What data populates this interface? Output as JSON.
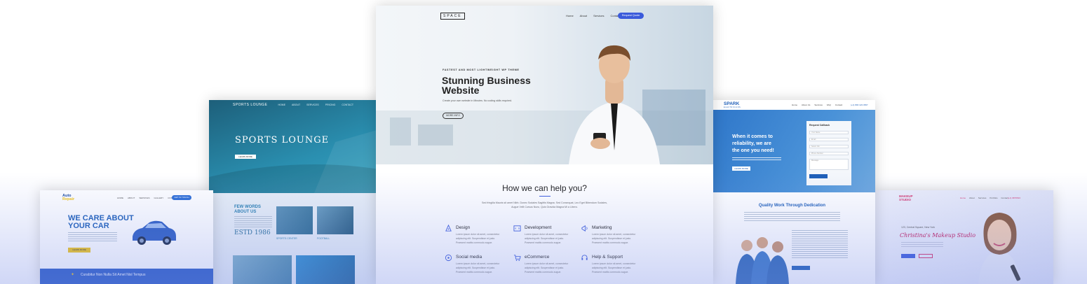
{
  "space": {
    "logo": "SPACE",
    "nav": [
      "Home",
      "About",
      "Services",
      "Contact"
    ],
    "request_button": "Request Quote",
    "kicker": "FASTEST AND MOST LIGHTWEIGHT WP THEME",
    "headline": "Stunning Business Website",
    "subtext": "Create your own website in Minutes. No coding skills required.",
    "more_button": "MORE INFO",
    "help_title": "How we can help you?",
    "intro_line1": "Sed fringilla Mauris sit amet Nibh. Donec Sodales Sagittis Magna. Sed Consequat, Leo Eget Bibendum Sodales,",
    "intro_line2": "Augue Velit Cursus Nunc, Quis Gravida Magna Mi a Libero.",
    "services": [
      {
        "name": "Design",
        "icon": "pen-tool-icon",
        "lines": [
          "Lorem ipsum dolor sit amet, consectetur",
          "adipiscing elit. Suspendisse et justo.",
          "Praesent mattis commodo augue."
        ]
      },
      {
        "name": "Development",
        "icon": "code-window-icon",
        "lines": [
          "Lorem ipsum dolor sit amet, consectetur",
          "adipiscing elit. Suspendisse et justo.",
          "Praesent mattis commodo augue."
        ]
      },
      {
        "name": "Marketing",
        "icon": "megaphone-icon",
        "lines": [
          "Lorem ipsum dolor sit amet, consectetur",
          "adipiscing elit. Suspendisse et justo.",
          "Praesent mattis commodo augue."
        ]
      },
      {
        "name": "Social media",
        "icon": "share-icon",
        "lines": [
          "Lorem ipsum dolor sit amet, consectetur",
          "adipiscing elit. Suspendisse et justo.",
          "Praesent mattis commodo augue."
        ]
      },
      {
        "name": "eCommerce",
        "icon": "cart-icon",
        "lines": [
          "Lorem ipsum dolor sit amet, consectetur",
          "adipiscing elit. Suspendisse et justo.",
          "Praesent mattis commodo augue."
        ]
      },
      {
        "name": "Help & Support",
        "icon": "support-icon",
        "lines": [
          "Lorem ipsum dolor sit amet, consectetur",
          "adipiscing elit. Suspendisse et justo.",
          "Praesent mattis commodo augue."
        ]
      }
    ]
  },
  "sports": {
    "logo": "SPORTS LOUNGE",
    "nav": [
      "HOME",
      "ABOUT",
      "SERVICES",
      "PRICING",
      "CONTACT"
    ],
    "title": "SPORTS LOUNGE",
    "button": "LEARN MORE",
    "few_words": "FEW WORDS ABOUT US",
    "estd": "ESTD 1986",
    "caption1": "SPORTS CENTER",
    "caption2": "FOOTBALL"
  },
  "auto": {
    "logo_line1": "Auto",
    "logo_line2": "Repair",
    "nav": [
      "HOME",
      "ABOUT",
      "SERVICES",
      "GALLERY",
      "CONTACT"
    ],
    "cta": "GET IN TOUCH",
    "headline_line1": "WE CARE ABOUT",
    "headline_line2": "YOUR CAR",
    "button": "LEARN MORE",
    "strip_text": "Curabitur Non Nulla Sit Amet Nisl Tempus"
  },
  "spark": {
    "logo": "SPARK",
    "logo_sub": "ELECTRICIANS",
    "nav": [
      "Home",
      "About Us",
      "Services",
      "FAQ",
      "Contact"
    ],
    "phone": "(+1) 800 123 4567",
    "hero_line1": "When it comes to",
    "hero_line2": "reliability, we are",
    "hero_line3": "the one you need!",
    "hero_button": "LEARN MORE",
    "form_title": "Request Callback",
    "form_fields": [
      "Your Name",
      "Email",
      "Select Job",
      "Phone Number",
      "Message"
    ],
    "quality_title": "Quality Work Through Dedication"
  },
  "makeup": {
    "logo_line1": "MAKEUP",
    "logo_line2": "STUDIO",
    "nav": [
      "Home",
      "About",
      "Services",
      "Portfolio",
      "Contact"
    ],
    "phone": "(+1) 9876543",
    "address": "123, Central Square, New York",
    "script": "Christina's Makeup Studio"
  },
  "colors": {
    "accent": "#3b5bdb",
    "sports_teal": "#2a8fb0",
    "spark_blue": "#1f5fb8",
    "makeup_pink": "#d6336c",
    "auto_yellow": "#f0c419"
  }
}
